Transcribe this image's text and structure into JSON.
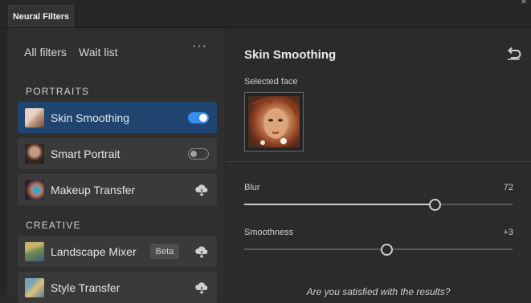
{
  "panel": {
    "tab_label": "Neural Filters"
  },
  "nav": {
    "all_filters": "All filters",
    "wait_list": "Wait list",
    "more": "···"
  },
  "sections": {
    "portraits": "PORTRAITS",
    "creative": "CREATIVE"
  },
  "filters": [
    {
      "label": "Skin Smoothing",
      "state": "on"
    },
    {
      "label": "Smart Portrait",
      "state": "off"
    },
    {
      "label": "Makeup Transfer",
      "state": "download"
    },
    {
      "label": "Landscape Mixer",
      "state": "download",
      "badge": "Beta"
    },
    {
      "label": "Style Transfer",
      "state": "download"
    }
  ],
  "detail": {
    "title": "Skin Smoothing",
    "selected_face_label": "Selected face",
    "sliders": [
      {
        "label": "Blur",
        "value_text": "72",
        "fraction": 0.71
      },
      {
        "label": "Smoothness",
        "value_text": "+3",
        "fraction": 0.53
      }
    ],
    "question": "Are you satisfied with the results?"
  },
  "colors": {
    "active_card": "#1f4470",
    "toggle_on": "#378ef0",
    "panel_bg": "#2b2b2b"
  }
}
